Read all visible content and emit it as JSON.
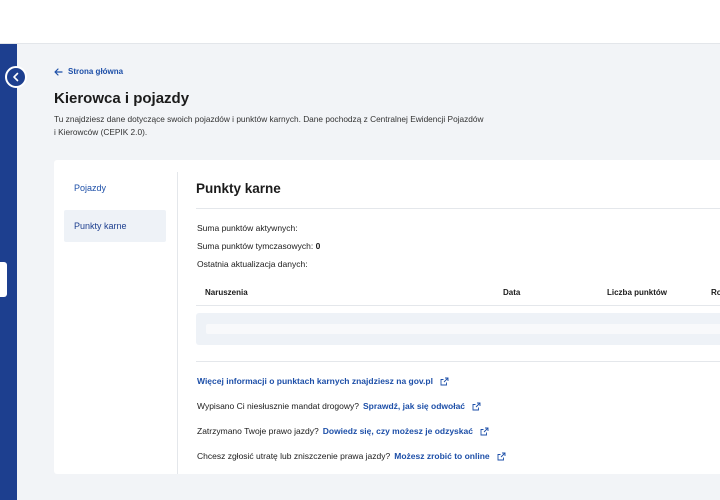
{
  "header": {},
  "back_link": {
    "label": "Strona główna"
  },
  "page": {
    "title": "Kierowca i pojazdy",
    "description_line1": "Tu znajdziesz dane dotyczące swoich pojazdów i punktów karnych. Dane pochodzą z Centralnej Ewidencji Pojazdów",
    "description_line2": "i Kierowców (CEPIK 2.0)."
  },
  "side_nav": {
    "items": [
      {
        "label": "Pojazdy",
        "active": false
      },
      {
        "label": "Punkty karne",
        "active": true
      }
    ]
  },
  "section": {
    "title": "Punkty karne",
    "active_points_label": "Suma punktów aktywnych:",
    "temp_points_label": "Suma punktów tymczasowych:",
    "temp_points_value": "0",
    "last_update_label": "Ostatnia aktualizacja danych:"
  },
  "table": {
    "headers": [
      "Naruszenia",
      "Data",
      "Liczba punktów",
      "Ro"
    ]
  },
  "links": [
    {
      "prefix": "",
      "link_text": "Więcej informacji o punktach karnych znajdziesz na gov.pl"
    },
    {
      "prefix": "Wypisano Ci niesłusznie mandat drogowy?",
      "link_text": "Sprawdź, jak się odwołać"
    },
    {
      "prefix": "Zatrzymano Twoje prawo jazdy?",
      "link_text": "Dowiedz się, czy możesz je odzyskać"
    },
    {
      "prefix": "Chcesz zgłosić utratę lub zniszczenie prawa jazdy?",
      "link_text": "Możesz zrobić to online"
    }
  ],
  "icons": {
    "collapse": "chevron-left-icon",
    "back": "arrow-left-icon",
    "external": "external-link-icon"
  },
  "colors": {
    "brand": "#1d3f8f",
    "link": "#1d4fa8",
    "background": "#f2f4f7"
  }
}
